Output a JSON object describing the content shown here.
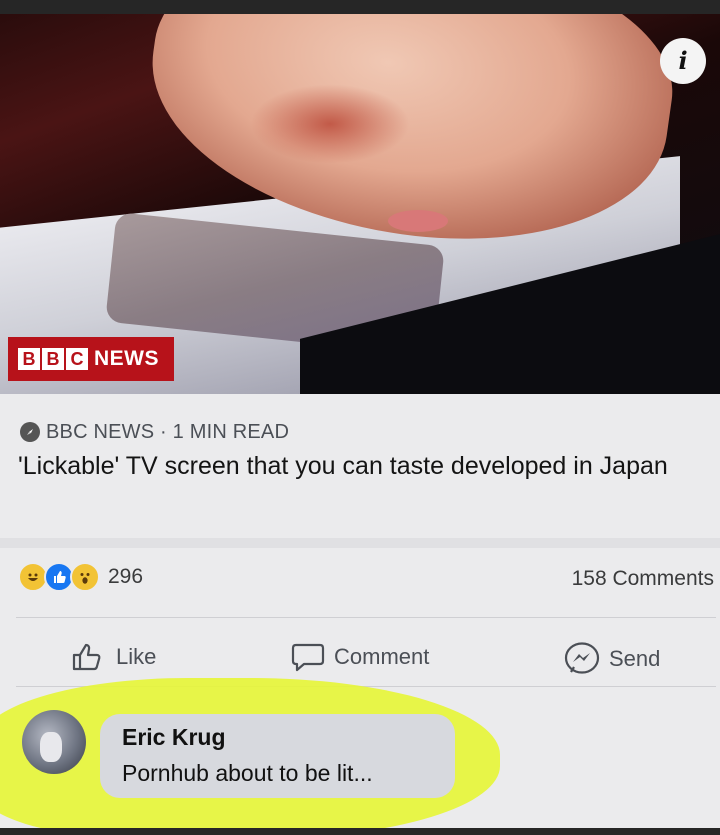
{
  "hero": {
    "badge_letters": [
      "B",
      "B",
      "C"
    ],
    "badge_label": "NEWS",
    "info_icon": "i"
  },
  "article": {
    "source": "BBC NEWS",
    "read_time": "1 MIN READ",
    "source_line": "BBC NEWS · 1 MIN READ",
    "headline": "'Lickable' TV screen that you can taste developed in Japan"
  },
  "engagement": {
    "reactions": [
      "haha-icon",
      "like-icon",
      "wow-icon"
    ],
    "reaction_count": "296",
    "comments_count": "158 Comments"
  },
  "actions": {
    "like": "Like",
    "comment": "Comment",
    "send": "Send"
  },
  "comment": {
    "author": "Eric Krug",
    "text": "Pornhub about to be lit..."
  },
  "colors": {
    "bbc_red": "#b7121a",
    "highlighter": "#e6f53a",
    "like_blue": "#1877f2"
  }
}
